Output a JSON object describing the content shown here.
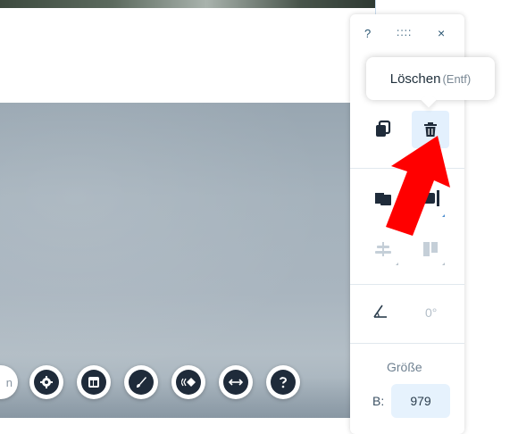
{
  "toolbar": {
    "help": "?",
    "drag": "::::",
    "close": "×"
  },
  "tooltip": {
    "action": "Löschen",
    "shortcut": "(Entf)"
  },
  "rotation": {
    "value": "0°"
  },
  "size": {
    "heading": "Größe",
    "width_label": "B:",
    "width_value": "979"
  },
  "fab_partial": {
    "text": "n"
  },
  "colors": {
    "accent": "#e3f0fd",
    "arrow": "#ff0000",
    "icon_dark": "#1f2b3a"
  }
}
